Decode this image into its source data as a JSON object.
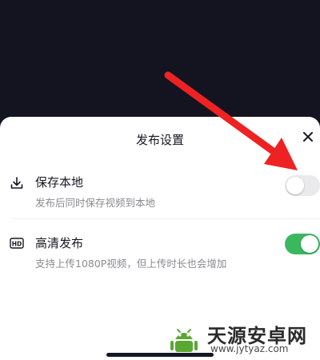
{
  "sheet": {
    "title": "发布设置",
    "close_icon": "close-icon"
  },
  "settings": [
    {
      "icon": "download-icon",
      "title": "保存本地",
      "subtitle": "发布后同时保存视频到本地",
      "enabled": false
    },
    {
      "icon": "hd-icon",
      "icon_text": "HD",
      "title": "高清发布",
      "subtitle": "支持上传1080P视频，但上传时长也会增加",
      "enabled": true
    }
  ],
  "colors": {
    "toggle_on": "#3bb75e",
    "toggle_off": "#eaeaec",
    "annotation_arrow": "#ee2222"
  },
  "watermark": {
    "name": "天源安卓网",
    "url": "www.jytyaz.com"
  }
}
